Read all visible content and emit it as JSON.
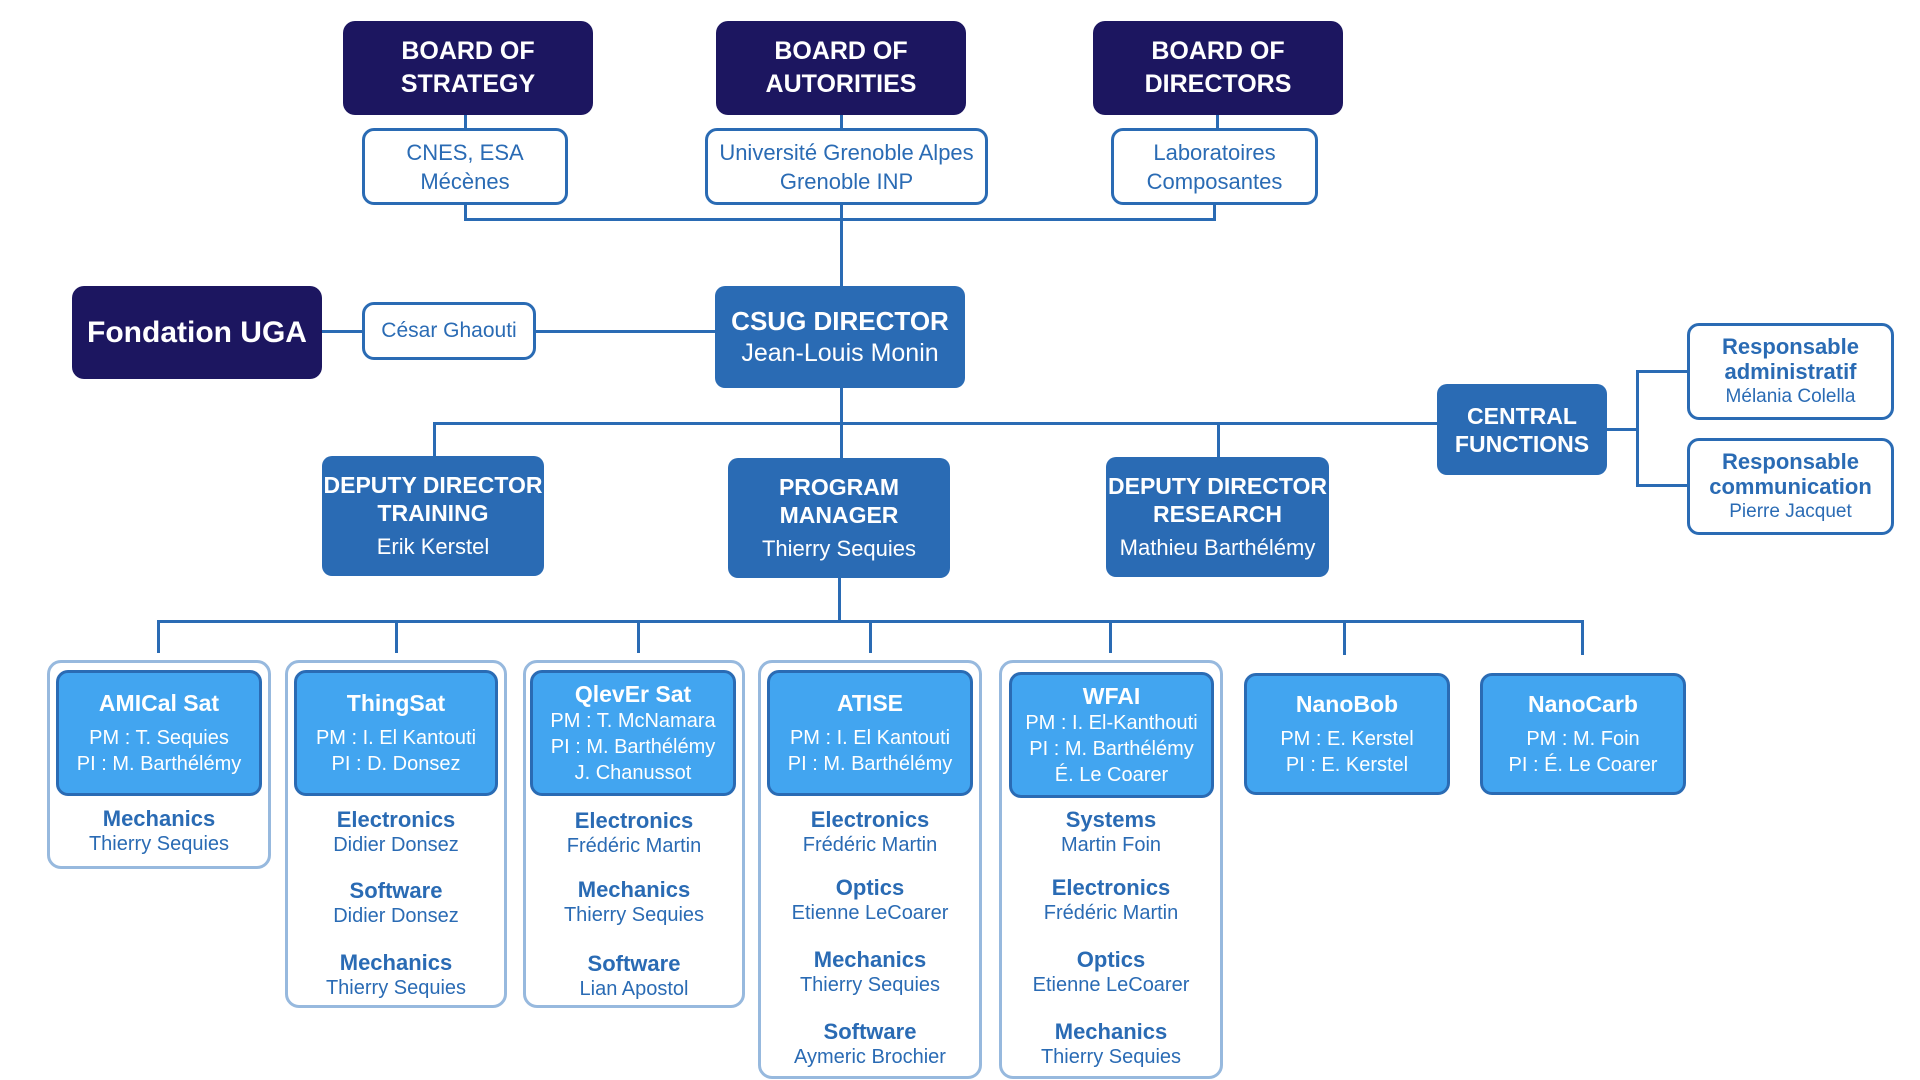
{
  "colors": {
    "navy": "#1C1660",
    "mid_blue": "#2A6BB4",
    "light_blue": "#42A5F0",
    "card_border": "#97B9DE"
  },
  "boards": [
    {
      "title_line1": "BOARD OF",
      "title_line2": "STRATEGY",
      "members_line1": "CNES, ESA",
      "members_line2": "Mécènes"
    },
    {
      "title_line1": "BOARD OF",
      "title_line2": "AUTORITIES",
      "members_line1": "Université Grenoble Alpes",
      "members_line2": "Grenoble INP"
    },
    {
      "title_line1": "BOARD OF",
      "title_line2": "DIRECTORS",
      "members_line1": "Laboratoires",
      "members_line2": "Composantes"
    }
  ],
  "fondation": {
    "title": "Fondation UGA",
    "contact": "César Ghaouti"
  },
  "director": {
    "title": "CSUG DIRECTOR",
    "name": "Jean-Louis Monin"
  },
  "central_functions": {
    "title_line1": "CENTRAL",
    "title_line2": "FUNCTIONS",
    "roles": [
      {
        "title_line1": "Responsable",
        "title_line2": "administratif",
        "name": "Mélania Colella"
      },
      {
        "title_line1": "Responsable",
        "title_line2": "communication",
        "name": "Pierre Jacquet"
      }
    ]
  },
  "deputies": [
    {
      "title_line1": "DEPUTY DIRECTOR",
      "title_line2": "TRAINING",
      "name": "Erik Kerstel"
    },
    {
      "title_line1": "PROGRAM",
      "title_line2": "MANAGER",
      "name": "Thierry Sequies"
    },
    {
      "title_line1": "DEPUTY DIRECTOR",
      "title_line2": "RESEARCH",
      "name": "Mathieu Barthélémy"
    }
  ],
  "projects": [
    {
      "name": "AMICal Sat",
      "lines": [
        "PM : T. Sequies",
        "PI : M. Barthélémy"
      ],
      "teams": [
        {
          "role": "Mechanics",
          "person": "Thierry Sequies"
        }
      ]
    },
    {
      "name": "ThingSat",
      "lines": [
        "PM : I. El Kantouti",
        "PI : D. Donsez"
      ],
      "teams": [
        {
          "role": "Electronics",
          "person": "Didier Donsez"
        },
        {
          "role": "Software",
          "person": "Didier Donsez"
        },
        {
          "role": "Mechanics",
          "person": "Thierry Sequies"
        }
      ]
    },
    {
      "name": "QlevEr Sat",
      "lines": [
        "PM : T. McNamara",
        "PI : M. Barthélémy",
        "J. Chanussot"
      ],
      "teams": [
        {
          "role": "Electronics",
          "person": "Frédéric Martin"
        },
        {
          "role": "Mechanics",
          "person": "Thierry Sequies"
        },
        {
          "role": "Software",
          "person": "Lian Apostol"
        }
      ]
    },
    {
      "name": "ATISE",
      "lines": [
        "PM : I. El Kantouti",
        "PI : M. Barthélémy"
      ],
      "teams": [
        {
          "role": "Electronics",
          "person": "Frédéric Martin"
        },
        {
          "role": "Optics",
          "person": "Etienne LeCoarer"
        },
        {
          "role": "Mechanics",
          "person": "Thierry Sequies"
        },
        {
          "role": "Software",
          "person": "Aymeric Brochier"
        }
      ]
    },
    {
      "name": "WFAI",
      "lines": [
        "PM : I. El-Kanthouti",
        "PI : M. Barthélémy",
        "É. Le Coarer"
      ],
      "teams": [
        {
          "role": "Systems",
          "person": "Martin Foin"
        },
        {
          "role": "Electronics",
          "person": "Frédéric Martin"
        },
        {
          "role": "Optics",
          "person": "Etienne LeCoarer"
        },
        {
          "role": "Mechanics",
          "person": "Thierry Sequies"
        }
      ]
    },
    {
      "name": "NanoBob",
      "lines": [
        "PM : E. Kerstel",
        "PI : E. Kerstel"
      ],
      "teams": []
    },
    {
      "name": "NanoCarb",
      "lines": [
        "PM : M. Foin",
        "PI : É. Le Coarer"
      ],
      "teams": []
    }
  ]
}
